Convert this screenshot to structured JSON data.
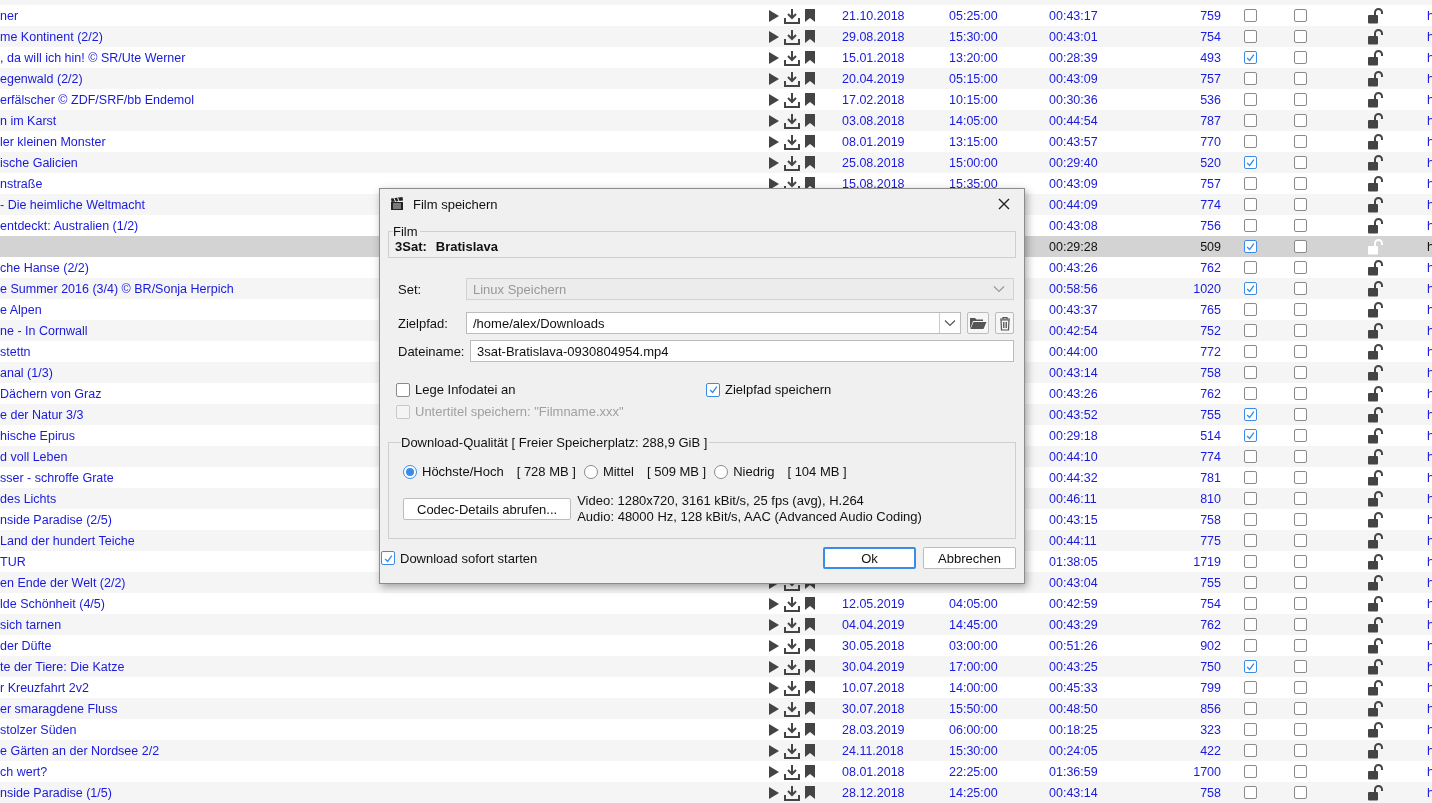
{
  "table": {
    "rows": [
      {
        "title": "ner",
        "actions": true,
        "date": "21.10.2018",
        "time": "05:25:00",
        "duration": "00:43:17",
        "size": "759",
        "check_1": false,
        "check_2": false,
        "link": "h",
        "selected": false
      },
      {
        "title": "me Kontinent (2/2)",
        "actions": true,
        "date": "29.08.2018",
        "time": "15:30:00",
        "duration": "00:43:01",
        "size": "754",
        "check_1": false,
        "check_2": false,
        "link": "h",
        "selected": false
      },
      {
        "title": ", da will ich hin! © SR/Ute Werner",
        "actions": true,
        "date": "15.01.2018",
        "time": "13:20:00",
        "duration": "00:28:39",
        "size": "493",
        "check_1": true,
        "check_2": false,
        "link": "h",
        "selected": false
      },
      {
        "title": "egenwald (2/2)",
        "actions": true,
        "date": "20.04.2019",
        "time": "05:15:00",
        "duration": "00:43:09",
        "size": "757",
        "check_1": false,
        "check_2": false,
        "link": "h",
        "selected": false
      },
      {
        "title": "erfälscher © ZDF/SRF/bb Endemol",
        "actions": true,
        "date": "17.02.2018",
        "time": "10:15:00",
        "duration": "00:30:36",
        "size": "536",
        "check_1": false,
        "check_2": false,
        "link": "h",
        "selected": false
      },
      {
        "title": "n im Karst",
        "actions": true,
        "date": "03.08.2018",
        "time": "14:05:00",
        "duration": "00:44:54",
        "size": "787",
        "check_1": false,
        "check_2": false,
        "link": "h",
        "selected": false
      },
      {
        "title": "ler kleinen Monster",
        "actions": true,
        "date": "08.01.2019",
        "time": "13:15:00",
        "duration": "00:43:57",
        "size": "770",
        "check_1": false,
        "check_2": false,
        "link": "h",
        "selected": false
      },
      {
        "title": "ische Galicien",
        "actions": true,
        "date": "25.08.2018",
        "time": "15:00:00",
        "duration": "00:29:40",
        "size": "520",
        "check_1": true,
        "check_2": false,
        "link": "h",
        "selected": false
      },
      {
        "title": "nstraße",
        "actions": true,
        "date": "15.08.2018",
        "time": "15:35:00",
        "duration": "00:43:09",
        "size": "757",
        "check_1": false,
        "check_2": false,
        "link": "h",
        "selected": false
      },
      {
        "title": "- Die heimliche Weltmacht",
        "actions": false,
        "duration": "00:44:09",
        "size": "774",
        "check_1": false,
        "check_2": false,
        "link": "h",
        "selected": false
      },
      {
        "title": "entdeckt: Australien (1/2)",
        "actions": false,
        "duration": "00:43:08",
        "size": "756",
        "check_1": false,
        "check_2": false,
        "link": "h",
        "selected": false
      },
      {
        "actions": false,
        "duration": "00:29:28",
        "size": "509",
        "check_1": true,
        "check_2": false,
        "link": "h",
        "selected": true
      },
      {
        "title": "che Hanse (2/2)",
        "actions": false,
        "duration": "00:43:26",
        "size": "762",
        "check_1": false,
        "check_2": false,
        "link": "h",
        "selected": false
      },
      {
        "title": "e Summer 2016 (3/4) © BR/Sonja Herpich",
        "actions": false,
        "duration": "00:58:56",
        "size": "1020",
        "check_1": true,
        "check_2": false,
        "link": "h",
        "selected": false
      },
      {
        "title": "e Alpen",
        "actions": false,
        "duration": "00:43:37",
        "size": "765",
        "check_1": false,
        "check_2": false,
        "link": "h",
        "selected": false
      },
      {
        "title": "ne - In Cornwall",
        "actions": false,
        "duration": "00:42:54",
        "size": "752",
        "check_1": false,
        "check_2": false,
        "link": "h",
        "selected": false
      },
      {
        "title": "stettn",
        "actions": false,
        "duration": "00:44:00",
        "size": "772",
        "check_1": false,
        "check_2": false,
        "link": "h",
        "selected": false
      },
      {
        "title": "anal (1/3)",
        "actions": false,
        "duration": "00:43:14",
        "size": "758",
        "check_1": false,
        "check_2": false,
        "link": "h",
        "selected": false
      },
      {
        "title": "Dächern von Graz",
        "actions": false,
        "duration": "00:43:26",
        "size": "762",
        "check_1": false,
        "check_2": false,
        "link": "h",
        "selected": false
      },
      {
        "title": "e der Natur 3/3",
        "actions": false,
        "duration": "00:43:52",
        "size": "755",
        "check_1": true,
        "check_2": false,
        "link": "h",
        "selected": false
      },
      {
        "title": "hische Epirus",
        "actions": false,
        "duration": "00:29:18",
        "size": "514",
        "check_1": true,
        "check_2": false,
        "link": "h",
        "selected": false
      },
      {
        "title": "d voll Leben",
        "actions": false,
        "duration": "00:44:10",
        "size": "774",
        "check_1": false,
        "check_2": false,
        "link": "h",
        "selected": false
      },
      {
        "title": "sser - schroffe Grate",
        "actions": false,
        "duration": "00:44:32",
        "size": "781",
        "check_1": false,
        "check_2": false,
        "link": "h",
        "selected": false
      },
      {
        "title": "des Lichts",
        "actions": false,
        "duration": "00:46:11",
        "size": "810",
        "check_1": false,
        "check_2": false,
        "link": "h",
        "selected": false
      },
      {
        "title": "nside Paradise (2/5)",
        "actions": false,
        "duration": "00:43:15",
        "size": "758",
        "check_1": false,
        "check_2": false,
        "link": "h",
        "selected": false
      },
      {
        "title": "Land der hundert Teiche",
        "actions": false,
        "duration": "00:44:11",
        "size": "775",
        "check_1": false,
        "check_2": false,
        "link": "h",
        "selected": false
      },
      {
        "title": "TUR",
        "actions": false,
        "duration": "01:38:05",
        "size": "1719",
        "check_1": false,
        "check_2": false,
        "link": "h",
        "selected": false
      },
      {
        "title": "en Ende der Welt (2/2)",
        "actions": true,
        "duration": "00:43:04",
        "size": "755",
        "check_1": false,
        "check_2": false,
        "link": "h",
        "selected": false
      },
      {
        "title": "lde Schönheit (4/5)",
        "actions": true,
        "date": "12.05.2019",
        "time": "04:05:00",
        "duration": "00:42:59",
        "size": "754",
        "check_1": false,
        "check_2": false,
        "link": "h",
        "selected": false
      },
      {
        "title": "sich tarnen",
        "actions": true,
        "date": "04.04.2019",
        "time": "14:45:00",
        "duration": "00:43:29",
        "size": "762",
        "check_1": false,
        "check_2": false,
        "link": "h",
        "selected": false
      },
      {
        "title": "der Düfte",
        "actions": true,
        "date": "30.05.2018",
        "time": "03:00:00",
        "duration": "00:51:26",
        "size": "902",
        "check_1": false,
        "check_2": false,
        "link": "h",
        "selected": false
      },
      {
        "title": "te der Tiere: Die Katze",
        "actions": true,
        "date": "30.04.2019",
        "time": "17:00:00",
        "duration": "00:43:25",
        "size": "750",
        "check_1": true,
        "check_2": false,
        "link": "h",
        "selected": false
      },
      {
        "title": "r Kreuzfahrt 2v2",
        "actions": true,
        "date": "10.07.2018",
        "time": "14:00:00",
        "duration": "00:45:33",
        "size": "799",
        "check_1": false,
        "check_2": false,
        "link": "h",
        "selected": false
      },
      {
        "title": "er smaragdene Fluss",
        "actions": true,
        "date": "30.07.2018",
        "time": "15:50:00",
        "duration": "00:48:50",
        "size": "856",
        "check_1": false,
        "check_2": false,
        "link": "h",
        "selected": false
      },
      {
        "title": "stolzer Süden",
        "actions": true,
        "date": "28.03.2019",
        "time": "06:00:00",
        "duration": "00:18:25",
        "size": "323",
        "check_1": false,
        "check_2": false,
        "link": "h",
        "selected": false
      },
      {
        "title": "e Gärten an der Nordsee 2/2",
        "actions": true,
        "date": "24.11.2018",
        "time": "15:30:00",
        "duration": "00:24:05",
        "size": "422",
        "check_1": false,
        "check_2": false,
        "link": "h",
        "selected": false
      },
      {
        "title": "ch wert?",
        "actions": true,
        "date": "08.01.2018",
        "time": "22:25:00",
        "duration": "01:36:59",
        "size": "1700",
        "check_1": false,
        "check_2": false,
        "link": "h",
        "selected": false
      },
      {
        "title": "nside Paradise (1/5)",
        "actions": true,
        "date": "28.12.2018",
        "time": "14:25:00",
        "duration": "00:43:14",
        "size": "758",
        "check_1": false,
        "check_2": false,
        "link": "h",
        "selected": false
      }
    ]
  },
  "dialog": {
    "title": "Film speichern",
    "film": {
      "legend": "Film",
      "channel": "3Sat:",
      "name": "Bratislava"
    },
    "fields": [
      {
        "kind": "select",
        "label": "Set:",
        "value": "Linux Speichern",
        "disabled": true
      },
      {
        "kind": "path",
        "label": "Zielpfad:",
        "value": "/home/alex/Downloads",
        "disabled": false
      },
      {
        "kind": "text",
        "label": "Dateiname:",
        "value": "3sat-Bratislava-0930804954.mp4",
        "disabled": false
      }
    ],
    "options": [
      {
        "label": "Lege Infodatei an",
        "checked": false,
        "disabled": false
      },
      {
        "label": "Zielpfad speichern",
        "checked": true,
        "disabled": false
      },
      {
        "label": "Untertitel speichern: \"Filmname.xxx\"",
        "checked": false,
        "disabled": true
      }
    ],
    "quality": {
      "legend": "Download-Qualität [ Freier Speicherplatz: 288,9 GiB ]",
      "choices": [
        {
          "label": "Höchste/Hoch",
          "size": "[ 728 MB ]",
          "selected": true
        },
        {
          "label": "Mittel",
          "size": "[ 509 MB ]",
          "selected": false
        },
        {
          "label": "Niedrig",
          "size": "[ 104 MB ]",
          "selected": false
        }
      ],
      "codec_button": "Codec-Details abrufen...",
      "video": "Video: 1280x720, 3161 kBit/s, 25 fps (avg), H.264",
      "audio": "Audio: 48000 Hz, 128 kBit/s, AAC (Advanced Audio Coding)"
    },
    "start_now": {
      "label": "Download sofort starten",
      "checked": true
    },
    "buttons": [
      {
        "label": "Ok",
        "focused": true
      },
      {
        "label": "Abbrechen",
        "focused": false
      }
    ]
  }
}
